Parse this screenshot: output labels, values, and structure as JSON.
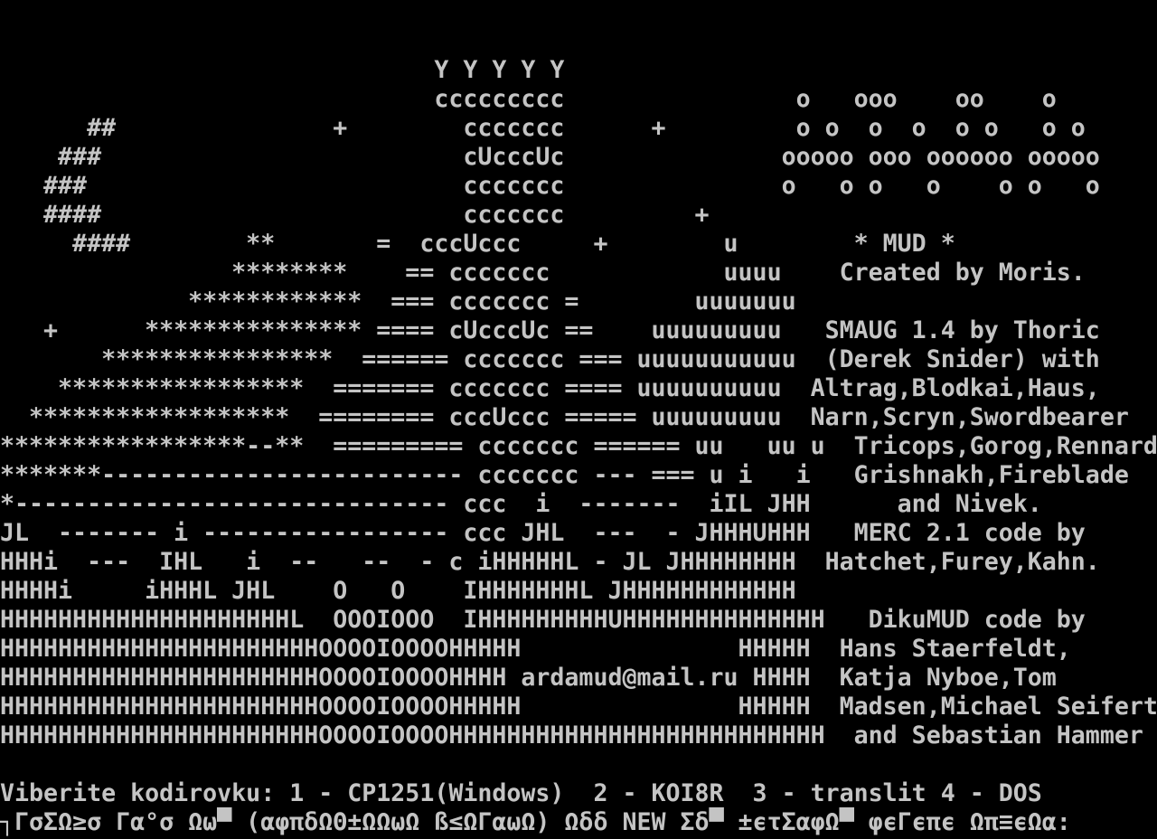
{
  "colors": {
    "background": "#000000",
    "text": "#c4c4c4"
  },
  "terminal": {
    "lines": [
      "                              Y Y Y Y Y",
      "                              ccccccccc                o   ooo    oo    o",
      "      ##               +        ccccccc      +         o o  o  o  o o   o o",
      "    ###                         cUcccUc               ooooo ooo oooooo ooooo",
      "   ###                          ccccccc               o   o o   o    o o   o",
      "   ####                         ccccccc         +",
      "     ####        **       =  cccUccc     +        u        * MUD *",
      "                ********    == ccccccc            uuuu    Created by Moris.",
      "             ************  === ccccccc =        uuuuuuu",
      "   +      *************** ==== cUcccUc ==    uuuuuuuuu   SMAUG 1.4 by Thoric",
      "       ****************  ====== ccccccc === uuuuuuuuuuu  (Derek Snider) with",
      "    *****************  ======= ccccccc ==== uuuuuuuuuu  Altrag,Blodkai,Haus,",
      "  ******************  ======== cccUccc ===== uuuuuuuuu  Narn,Scryn,Swordbearer",
      "*****************--**  ========= ccccccc ====== uu   uu u  Tricops,Gorog,Rennard,",
      "*******------------------------- ccccccc --- === u i   i   Grishnakh,Fireblade",
      "*------------------------------ ccc  i  -------  iIL JHH      and Nivek.",
      "JL  ------- i ----------------- ccc JHL  ---  - JHHHUHHH   MERC 2.1 code by",
      "HHHi  ---  IHL   i  --   --  - c iHHHHHL - JL JHHHHHHHH  Hatchet,Furey,Kahn.",
      "HHHHi     iHHHL JHL    O   O    IHHHHHHHL JHHHHHHHHHHHH",
      "HHHHHHHHHHHHHHHHHHHHL  OOOIOOO  IHHHHHHHHHUHHHHHHHHHHHHHH   DikuMUD code by",
      "HHHHHHHHHHHHHHHHHHHHHHOOOOIOOOOHHHHH               HHHHH  Hans Staerfeldt,",
      "HHHHHHHHHHHHHHHHHHHHHHOOOOIOOOOHHHH ardamud@mail.ru HHHH  Katja Nyboe,Tom",
      "HHHHHHHHHHHHHHHHHHHHHHOOOOIOOOOHHHHH               HHHHH  Madsen,Michael Seifert",
      "HHHHHHHHHHHHHHHHHHHHHHOOOOIOOOOHHHHHHHHHHHHHHHHHHHHHHHHHH  and Sebastian Hammer",
      "",
      "Viberite kodirovku: 1 - CP1251(Windows)  2 - KOI8R  3 - translit 4 - DOS",
      "┐ΓσΣΩ≥σ Γα°σ Ωω▀ (αφπδΩΘ±ΩΩωΩ ß≤ΩΓαωΩ) Ωδδ NEW Σδ▀ ±ϵτΣαφΩ▀ φϵΓϵπϵ Ωπ≡ϵΩα:"
    ]
  }
}
